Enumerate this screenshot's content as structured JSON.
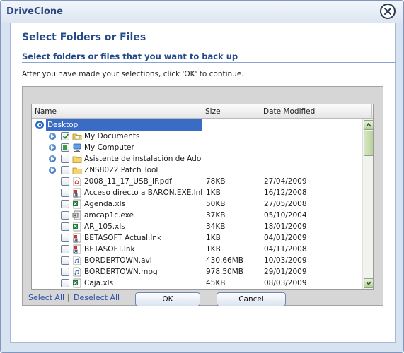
{
  "window": {
    "title": "DriveClone",
    "close_icon": "close-icon"
  },
  "dialog": {
    "heading": "Select Folders or Files",
    "subheading": "Select folders or files that you want to back up",
    "instructions": "After you have made your selections, click 'OK' to continue."
  },
  "columns": {
    "name": "Name",
    "size": "Size",
    "date": "Date Modified"
  },
  "tree": [
    {
      "name": "Desktop",
      "icon": "desktop-icon",
      "level": 0,
      "selected": true,
      "expander": false,
      "checkbox": false,
      "size": "",
      "date": ""
    },
    {
      "name": "My Documents",
      "icon": "folder-documents-icon",
      "level": 1,
      "expander": true,
      "checkbox": true,
      "check": "checked",
      "size": "",
      "date": ""
    },
    {
      "name": "My Computer",
      "icon": "computer-icon",
      "level": 1,
      "expander": true,
      "checkbox": true,
      "check": "partial",
      "size": "",
      "date": ""
    },
    {
      "name": "Asistente de instalación de Ado...",
      "icon": "folder-icon",
      "level": 1,
      "expander": true,
      "checkbox": true,
      "check": "none",
      "size": "",
      "date": ""
    },
    {
      "name": "ZNS8022 Patch Tool",
      "icon": "folder-icon",
      "level": 1,
      "expander": true,
      "checkbox": true,
      "check": "none",
      "size": "",
      "date": ""
    },
    {
      "name": "2008_11_17_USB_IF.pdf",
      "icon": "pdf-file-icon",
      "level": 1,
      "expander": false,
      "checkbox": true,
      "check": "none",
      "size": "78KB",
      "date": "27/04/2009"
    },
    {
      "name": "Acceso directo a BARON.EXE.lnk",
      "icon": "shortcut-file-icon",
      "level": 1,
      "expander": false,
      "checkbox": true,
      "check": "none",
      "size": "1KB",
      "date": "16/12/2008"
    },
    {
      "name": "Agenda.xls",
      "icon": "excel-file-icon",
      "level": 1,
      "expander": false,
      "checkbox": true,
      "check": "none",
      "size": "50KB",
      "date": "27/05/2008"
    },
    {
      "name": "amcap1c.exe",
      "icon": "exe-file-icon",
      "level": 1,
      "expander": false,
      "checkbox": true,
      "check": "none",
      "size": "37KB",
      "date": "05/10/2004"
    },
    {
      "name": "AR_105.xls",
      "icon": "excel-file-icon",
      "level": 1,
      "expander": false,
      "checkbox": true,
      "check": "none",
      "size": "34KB",
      "date": "18/01/2009"
    },
    {
      "name": "BETASOFT Actual.lnk",
      "icon": "shortcut-file-icon",
      "level": 1,
      "expander": false,
      "checkbox": true,
      "check": "none",
      "size": "1KB",
      "date": "04/01/2009"
    },
    {
      "name": "BETASOFT.lnk",
      "icon": "shortcut-file-icon",
      "level": 1,
      "expander": false,
      "checkbox": true,
      "check": "none",
      "size": "1KB",
      "date": "04/11/2008"
    },
    {
      "name": "BORDERTOWN.avi",
      "icon": "media-file-icon",
      "level": 1,
      "expander": false,
      "checkbox": true,
      "check": "none",
      "size": "430.66MB",
      "date": "10/03/2009"
    },
    {
      "name": "BORDERTOWN.mpg",
      "icon": "media-file-icon",
      "level": 1,
      "expander": false,
      "checkbox": true,
      "check": "none",
      "size": "978.50MB",
      "date": "29/01/2009"
    },
    {
      "name": "Caja.xls",
      "icon": "excel-file-icon",
      "level": 1,
      "expander": false,
      "checkbox": true,
      "check": "none",
      "size": "45KB",
      "date": "08/03/2009"
    }
  ],
  "links": {
    "select_all": "Select All",
    "separator": "|",
    "deselect_all": "Deselect All"
  },
  "buttons": {
    "ok": "OK",
    "cancel": "Cancel"
  },
  "colors": {
    "accent": "#244a8a",
    "selection": "#3b6cc5",
    "frame": "#d8e3f1"
  }
}
